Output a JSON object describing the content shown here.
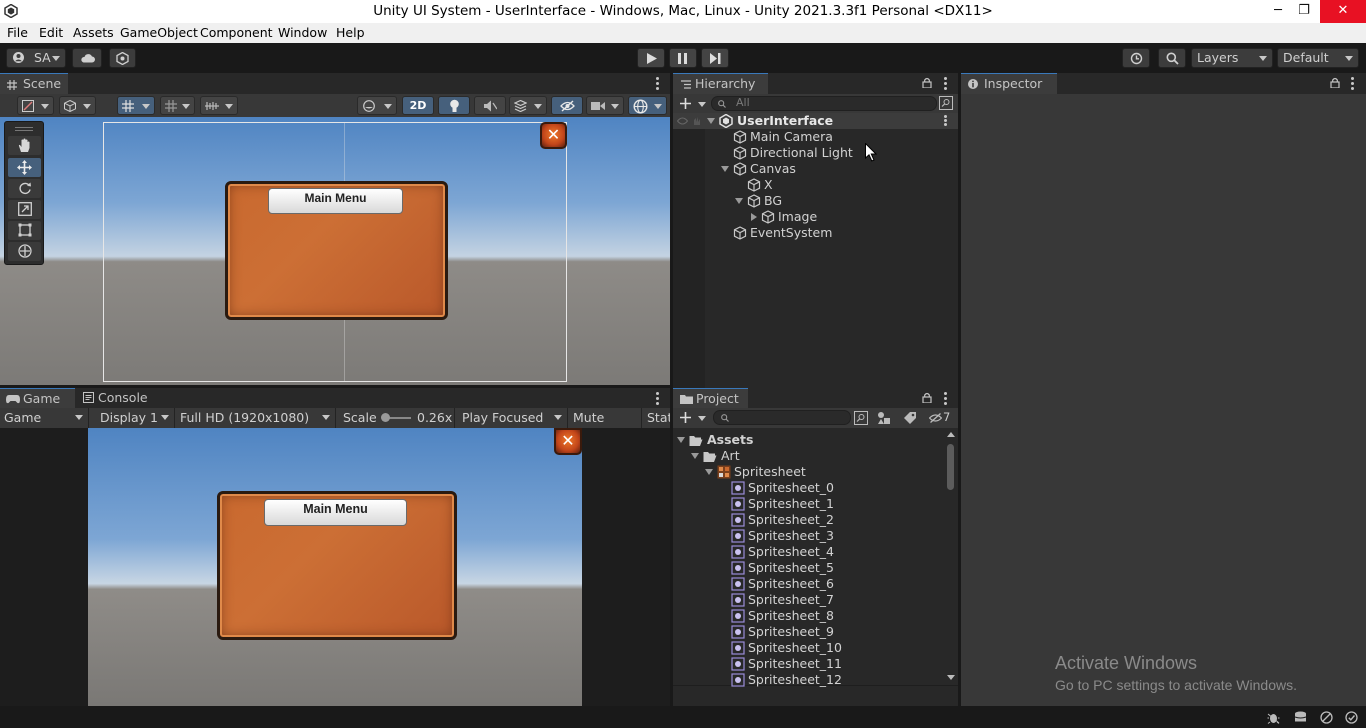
{
  "window": {
    "title": "Unity UI System - UserInterface - Windows, Mac, Linux - Unity 2021.3.3f1 Personal <DX11>",
    "minimize": "─",
    "restore": "❐",
    "close": "✕"
  },
  "menu": [
    "File",
    "Edit",
    "Assets",
    "GameObject",
    "Component",
    "Window",
    "Help"
  ],
  "toolbar": {
    "account": "SA",
    "layers": "Layers",
    "layout": "Default"
  },
  "scene": {
    "tab_label": "Scene",
    "mode_2d": "2D",
    "panel_title": "Main Menu"
  },
  "game": {
    "tabs": [
      "Game",
      "Console"
    ],
    "view_select": "Game",
    "display_select": "Display 1",
    "resolution_select": "Full HD (1920x1080)",
    "scale_label": "Scale",
    "scale_value": "0.26x",
    "play_mode_select": "Play Focused",
    "mute_audio": "Mute Audio",
    "stats": "Stat",
    "panel_title": "Main Menu"
  },
  "hierarchy": {
    "tab_label": "Hierarchy",
    "search_placeholder": "All",
    "items": [
      {
        "label": "UserInterface"
      },
      {
        "label": "Main Camera"
      },
      {
        "label": "Directional Light"
      },
      {
        "label": "Canvas"
      },
      {
        "label": "X"
      },
      {
        "label": "BG"
      },
      {
        "label": "Image"
      },
      {
        "label": "EventSystem"
      }
    ]
  },
  "project": {
    "tab_label": "Project",
    "hidden_count": "7",
    "items": [
      {
        "label": "Assets"
      },
      {
        "label": "Art"
      },
      {
        "label": "Spritesheet"
      },
      {
        "label": "Spritesheet_0"
      },
      {
        "label": "Spritesheet_1"
      },
      {
        "label": "Spritesheet_2"
      },
      {
        "label": "Spritesheet_3"
      },
      {
        "label": "Spritesheet_4"
      },
      {
        "label": "Spritesheet_5"
      },
      {
        "label": "Spritesheet_6"
      },
      {
        "label": "Spritesheet_7"
      },
      {
        "label": "Spritesheet_8"
      },
      {
        "label": "Spritesheet_9"
      },
      {
        "label": "Spritesheet_10"
      },
      {
        "label": "Spritesheet_11"
      },
      {
        "label": "Spritesheet_12"
      }
    ]
  },
  "inspector": {
    "tab_label": "Inspector"
  },
  "watermark": {
    "title": "Activate Windows",
    "subtitle": "Go to PC settings to activate Windows."
  },
  "colors": {
    "accent_blue": "#3a79bb",
    "selection": "#46607c",
    "panel_orange": "#c9692f"
  }
}
